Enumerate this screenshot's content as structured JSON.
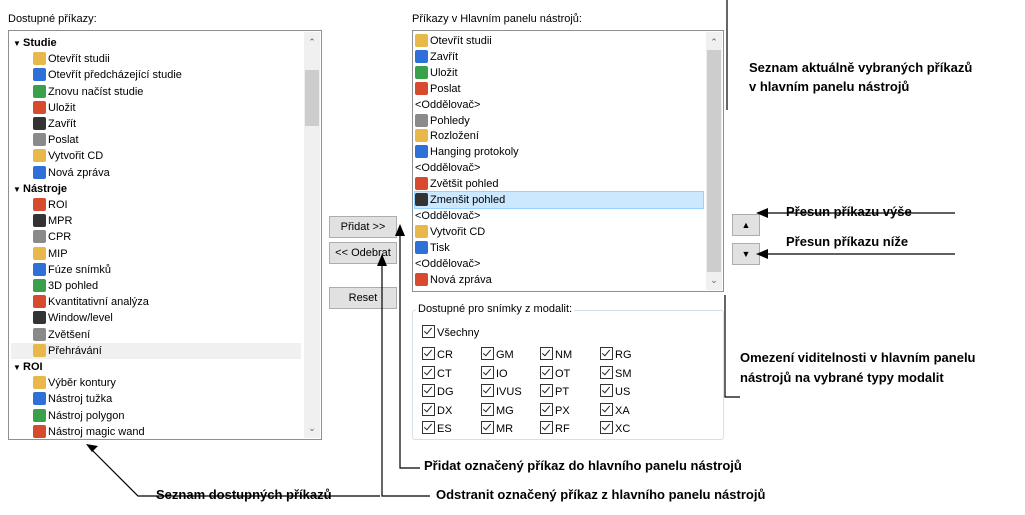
{
  "available": {
    "label": "Dostupné příkazy:",
    "groups": [
      {
        "name": "Studie",
        "items": [
          "Otevřít studii",
          "Otevřít předcházející studie",
          "Znovu načíst studie",
          "Uložit",
          "Zavřít",
          "Poslat",
          "Vytvořit CD",
          "Nová zpráva"
        ]
      },
      {
        "name": "Nástroje",
        "items": [
          "ROI",
          "MPR",
          "CPR",
          "MIP",
          "Fúze snímků",
          "3D pohled",
          "Kvantitativní analýza",
          "Window/level",
          "Zvětšení",
          "Přehrávání"
        ]
      },
      {
        "name": "ROI",
        "items": [
          "Výběr kontury",
          "Nástroj tužka",
          "Nástroj polygon",
          "Nástroj magic wand"
        ]
      }
    ],
    "highlighted_item": "Přehrávání"
  },
  "toolbar": {
    "label": "Příkazy v Hlavním panelu nástrojů:",
    "items": [
      "Otevřít studii",
      "Zavřít",
      "Uložit",
      "Poslat",
      "<Oddělovač>",
      "Pohledy",
      "Rozložení",
      "Hanging protokoly",
      "<Oddělovač>",
      "Zvětšit pohled",
      "Zmenšit pohled",
      "<Oddělovač>",
      "Vytvořit CD",
      "Tisk",
      "<Oddělovač>",
      "Nová zpráva"
    ],
    "selected_item": "Zmenšit pohled"
  },
  "buttons": {
    "add": "Přidat >>",
    "remove": "<< Odebrat",
    "reset": "Reset"
  },
  "modality": {
    "legend": "Dostupné pro snímky z modalit:",
    "all": "Všechny",
    "columns": [
      [
        "CR",
        "CT",
        "DG",
        "DX",
        "ES"
      ],
      [
        "GM",
        "IO",
        "IVUS",
        "MG",
        "MR"
      ],
      [
        "NM",
        "OT",
        "PT",
        "PX",
        "RF"
      ],
      [
        "RG",
        "SM",
        "US",
        "XA",
        "XC"
      ]
    ]
  },
  "notes": {
    "toolbar_list": "Seznam aktuálně vybraných příkazů",
    "toolbar_list2": "v hlavním panelu nástrojů",
    "move_up": "Přesun příkazu výše",
    "move_down": "Přesun příkazu níže",
    "modality1": "Omezení viditelnosti v hlavním panelu",
    "modality2": "nástrojů na vybrané typy modalit",
    "add": "Přidat označený příkaz do hlavního panelu nástrojů",
    "remove": "Odstranit označený příkaz z hlavního panelu nástrojů",
    "available_list": "Seznam dostupných příkazů"
  },
  "icon_colors": {
    "folder": "#e8b84a",
    "blue": "#2e6fd8",
    "green": "#3aa14a",
    "red": "#d84a2e",
    "dark": "#333333",
    "gray": "#8a8a8a"
  }
}
